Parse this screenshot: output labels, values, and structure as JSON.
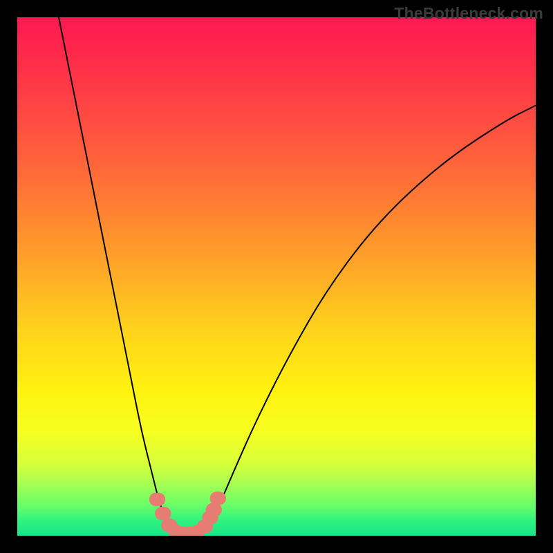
{
  "watermark": "TheBottleneck.com",
  "colors": {
    "gradient_top": "#ff1852",
    "gradient_mid_orange": "#ffa628",
    "gradient_mid_yellow": "#fff210",
    "gradient_bottom": "#18e48a",
    "curve": "#000000",
    "marker": "#e67c72",
    "background": "#000000"
  },
  "chart_data": {
    "type": "line",
    "title": "",
    "xlabel": "",
    "ylabel": "",
    "x_range": [
      0,
      100
    ],
    "y_range": [
      0,
      100
    ],
    "curve_points": [
      {
        "x": 8.0,
        "y": 100.0
      },
      {
        "x": 10.0,
        "y": 90.0
      },
      {
        "x": 13.0,
        "y": 75.0
      },
      {
        "x": 16.0,
        "y": 60.0
      },
      {
        "x": 19.0,
        "y": 45.0
      },
      {
        "x": 22.0,
        "y": 30.0
      },
      {
        "x": 24.0,
        "y": 20.0
      },
      {
        "x": 26.0,
        "y": 12.0
      },
      {
        "x": 27.5,
        "y": 6.0
      },
      {
        "x": 29.0,
        "y": 2.5
      },
      {
        "x": 31.0,
        "y": 0.8
      },
      {
        "x": 33.0,
        "y": 0.5
      },
      {
        "x": 35.0,
        "y": 0.8
      },
      {
        "x": 37.0,
        "y": 2.5
      },
      {
        "x": 39.0,
        "y": 6.0
      },
      {
        "x": 42.0,
        "y": 13.0
      },
      {
        "x": 46.0,
        "y": 22.0
      },
      {
        "x": 52.0,
        "y": 34.0
      },
      {
        "x": 60.0,
        "y": 48.0
      },
      {
        "x": 70.0,
        "y": 61.0
      },
      {
        "x": 82.0,
        "y": 72.0
      },
      {
        "x": 94.0,
        "y": 80.0
      },
      {
        "x": 100.0,
        "y": 83.0
      }
    ],
    "markers": [
      {
        "x": 27.0,
        "y": 7.0,
        "r": 1.3
      },
      {
        "x": 28.1,
        "y": 4.3,
        "r": 1.3
      },
      {
        "x": 29.3,
        "y": 2.0,
        "r": 1.3
      },
      {
        "x": 30.5,
        "y": 0.9,
        "r": 1.2
      },
      {
        "x": 32.0,
        "y": 0.55,
        "r": 1.2
      },
      {
        "x": 33.4,
        "y": 0.55,
        "r": 1.2
      },
      {
        "x": 34.8,
        "y": 0.8,
        "r": 1.2
      },
      {
        "x": 36.2,
        "y": 1.8,
        "r": 1.3
      },
      {
        "x": 37.2,
        "y": 3.5,
        "r": 1.3
      },
      {
        "x": 37.9,
        "y": 5.0,
        "r": 1.3
      },
      {
        "x": 38.7,
        "y": 7.2,
        "r": 1.3
      }
    ],
    "note": "Values are read as percentages of the plot box (0-100 on each axis). The curve is a V-shaped bottleneck plot with its minimum near x≈33, y≈0.5; the left branch is steep reaching y=100 at x≈8 and the right branch rises asymptotically to about y≈83 at x=100. Salmon-colored circular markers sit along the bottom of the V."
  }
}
